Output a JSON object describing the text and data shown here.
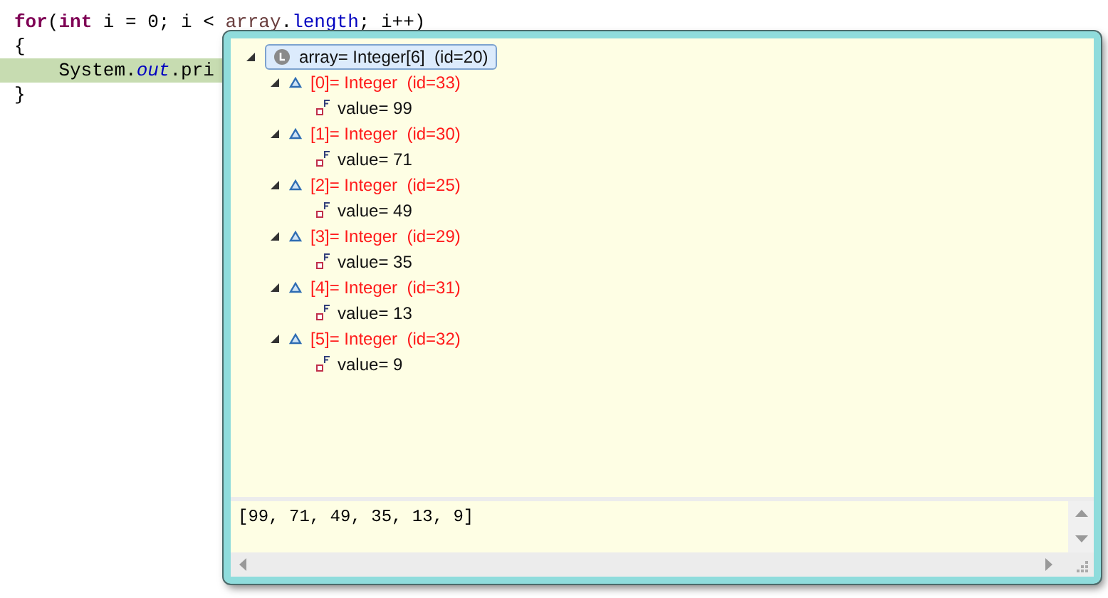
{
  "editor": {
    "lines": [
      {
        "highlighted": false,
        "tokens": [
          {
            "text": "for",
            "kind": "keyword"
          },
          {
            "text": "(",
            "kind": "plain"
          },
          {
            "text": "int",
            "kind": "keyword"
          },
          {
            "text": " i = 0; i < ",
            "kind": "plain"
          },
          {
            "text": "array",
            "kind": "local"
          },
          {
            "text": ".",
            "kind": "plain"
          },
          {
            "text": "length",
            "kind": "field"
          },
          {
            "text": "; i++)",
            "kind": "plain"
          }
        ]
      },
      {
        "highlighted": false,
        "tokens": [
          {
            "text": "{",
            "kind": "plain"
          }
        ]
      },
      {
        "highlighted": true,
        "tokens": [
          {
            "text": "    System.",
            "kind": "plain"
          },
          {
            "text": "out",
            "kind": "static"
          },
          {
            "text": ".pri",
            "kind": "plain"
          }
        ]
      },
      {
        "highlighted": false,
        "tokens": [
          {
            "text": "}",
            "kind": "plain"
          }
        ]
      }
    ]
  },
  "popup": {
    "root": {
      "label": "array= Integer[6]  (id=20)",
      "expanded": true,
      "selected": true,
      "children": [
        {
          "label": "[0]= Integer  (id=33)",
          "expanded": true,
          "field": "value= 99"
        },
        {
          "label": "[1]= Integer  (id=30)",
          "expanded": true,
          "field": "value= 71"
        },
        {
          "label": "[2]= Integer  (id=25)",
          "expanded": true,
          "field": "value= 49"
        },
        {
          "label": "[3]= Integer  (id=29)",
          "expanded": true,
          "field": "value= 35"
        },
        {
          "label": "[4]= Integer  (id=31)",
          "expanded": true,
          "field": "value= 13"
        },
        {
          "label": "[5]= Integer  (id=32)",
          "expanded": true,
          "field": "value= 9"
        }
      ]
    },
    "detail": "[99, 71, 49, 35, 13, 9]"
  }
}
